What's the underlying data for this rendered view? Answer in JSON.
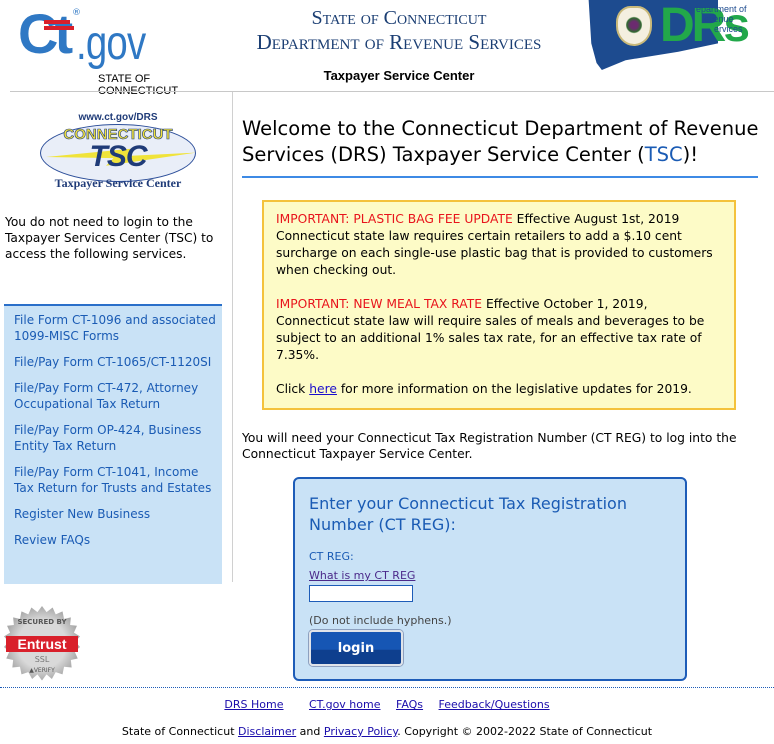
{
  "header": {
    "ctgov_logo": {
      "text_ct": "Ct",
      "text_gov": ".gov",
      "registered": "®",
      "state_label": "STATE OF CONNECTICUT"
    },
    "agency_line1": "State of Connecticut",
    "agency_line2": "Department of Revenue Services",
    "subtitle": "Taxpayer Service Center",
    "drs_logo": {
      "letters": "DRs",
      "word1": "epartment of",
      "word2": "evenue",
      "word3": "ervices"
    },
    "colors": {
      "ctgov_blue": "#2f78c4",
      "drs_green": "#22a84a",
      "drs_navy": "#1d4b8f",
      "agency_title": "#1b3e73"
    }
  },
  "sidebar": {
    "tsc_logo": {
      "url": "www.ct.gov/DRS",
      "state": "CONNECTICUT",
      "acronym": "TSC",
      "name": "Taxpayer Service Center"
    },
    "intro": "You do not need to login to the Taxpayer Services Center (TSC) to access the following services.",
    "services": [
      {
        "label": "File Form CT-1096 and associated 1099-MISC Forms"
      },
      {
        "label": "File/Pay Form CT-1065/CT-1120SI"
      },
      {
        "label": "File/Pay Form CT-472, Attorney Occupational Tax Return"
      },
      {
        "label": "File/Pay Form OP-424, Business Entity Tax Return"
      },
      {
        "label": "File/Pay Form CT-1041, Income Tax Return for Trusts and Estates"
      },
      {
        "label": "Register New Business"
      },
      {
        "label": "Review FAQs"
      }
    ],
    "entrust_seal": {
      "top": "SECURED BY",
      "brand": "Entrust",
      "ssl": "SSL",
      "verify": "▲VERIFY"
    }
  },
  "main": {
    "welcome_prefix": "Welcome to the Connecticut Department of Revenue Services (DRS) Taxpayer Service Center (",
    "welcome_link": "TSC",
    "welcome_suffix": ")!",
    "notice": {
      "item1_alert": "IMPORTANT: PLASTIC BAG FEE UPDATE",
      "item1_text": " Effective August 1st, 2019 Connecticut state law requires certain retailers to add a $.10 cent surcharge on each single-use plastic bag that is provided to customers when checking out.",
      "item2_alert": "IMPORTANT: NEW MEAL TAX RATE",
      "item2_text": " Effective October 1, 2019, Connecticut state law will require sales of meals and beverages to be subject to an additional 1% sales tax rate, for an effective tax rate of 7.35%.",
      "click_prefix": "Click ",
      "click_link": "here",
      "click_suffix": " for more information on the legislative updates for 2019.",
      "colors": {
        "background": "#fdfbc7",
        "border": "#f4c23c",
        "alert": "#e8141c"
      }
    },
    "need_ctreg": "You will need your Connecticut Tax Registration Number (CT REG) to log into the Connecticut Taxpayer Service Center.",
    "login_box": {
      "title": "Enter your Connecticut Tax Registration Number (CT REG):",
      "field_label": "CT REG:",
      "help_link": "What is my CT REG",
      "input_value": "",
      "hint": "(Do not include hyphens.)",
      "button_label": "login",
      "colors": {
        "background": "#c9e2f6",
        "border": "#1d5cb8",
        "button": "#1656b4"
      }
    }
  },
  "footer": {
    "links": [
      "DRS Home",
      "CT.gov home",
      "FAQs",
      "Feedback/Questions"
    ],
    "copyright_prefix": "State of Connecticut ",
    "disclaimer_link": "Disclaimer",
    "and_text": " and ",
    "privacy_link": "Privacy Policy",
    "copyright_suffix": ". Copyright © 2002-2022 State of Connecticut"
  }
}
